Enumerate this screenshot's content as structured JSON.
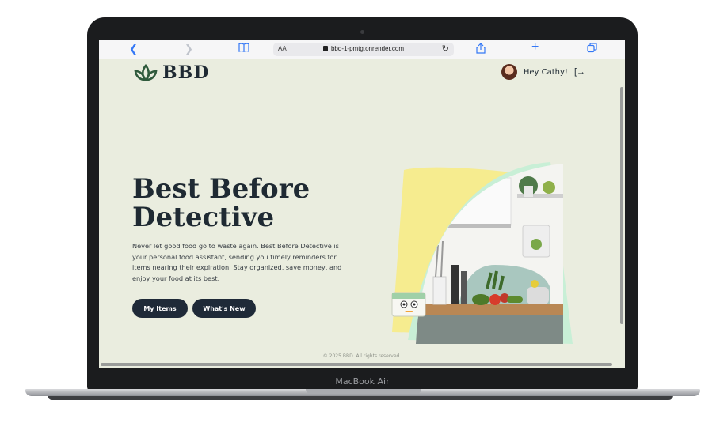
{
  "device": {
    "label": "MacBook Air"
  },
  "browser": {
    "url": "bbd-1-pmtg.onrender.com",
    "text_size_label": "AA"
  },
  "header": {
    "logo_text": "BBD",
    "greeting": "Hey Cathy!"
  },
  "hero": {
    "title_line1": "Best Before",
    "title_line2": "Detective",
    "description": "Never let good food go to waste again. Best Before Detective is your personal food assistant, sending you timely reminders for items nearing their expiration. Stay organized, save money, and enjoy your food at its best.",
    "buttons": {
      "my_items": "My Items",
      "whats_new": "What's New"
    }
  },
  "footer": {
    "text": "© 2025 BBD. All rights reserved."
  },
  "colors": {
    "background": "#eaeddf",
    "primary_dark": "#1f2a38",
    "leaf_green": "#2f5a3c",
    "accent_yellow": "#f6ec8f",
    "accent_mint": "#bfeed0",
    "link_blue": "#3478f6"
  },
  "icons": [
    "back-icon",
    "forward-icon",
    "bookmarks-icon",
    "lock-icon",
    "reload-icon",
    "share-icon",
    "new-tab-icon",
    "tabs-icon",
    "leaf-logo-icon",
    "logout-icon"
  ]
}
